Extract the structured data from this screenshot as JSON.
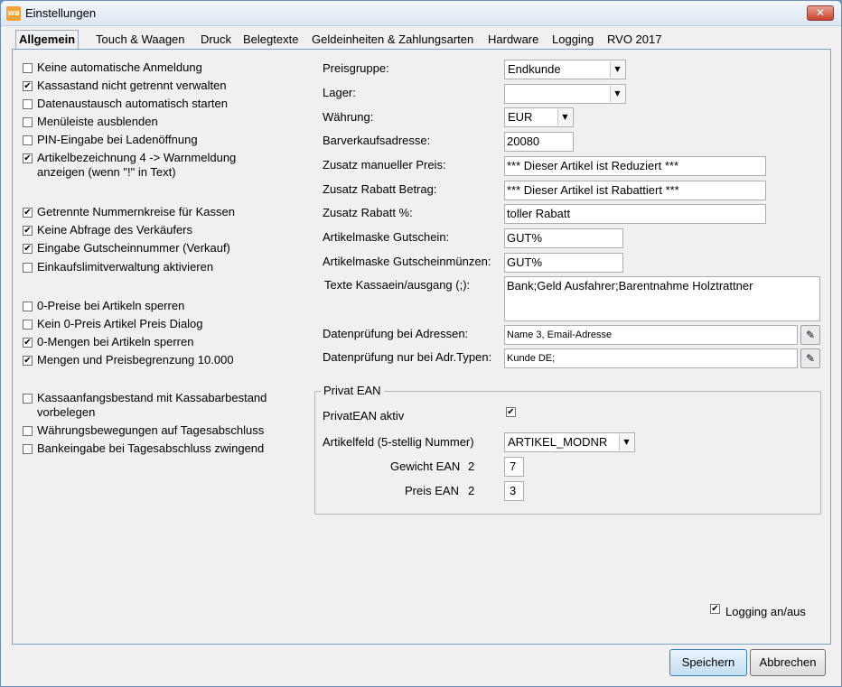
{
  "window": {
    "title": "Einstellungen",
    "icon": "app-icon",
    "close": "✕"
  },
  "tabs": [
    {
      "label": "Allgemein"
    },
    {
      "label": "Touch & Waagen"
    },
    {
      "label": "Druck"
    },
    {
      "label": "Belegtexte"
    },
    {
      "label": "Geldeinheiten & Zahlungsarten"
    },
    {
      "label": "Hardware"
    },
    {
      "label": "Logging"
    },
    {
      "label": "RVO 2017"
    }
  ],
  "checks": [
    {
      "label": "Keine automatische Anmeldung",
      "checked": false
    },
    {
      "label": "Kassastand nicht getrennt verwalten",
      "checked": true
    },
    {
      "label": "Datenaustausch automatisch starten",
      "checked": false
    },
    {
      "label": "Menüleiste ausblenden",
      "checked": false
    },
    {
      "label": "PIN-Eingabe bei Ladenöffnung",
      "checked": false
    },
    {
      "label": "Artikelbezeichnung 4 -> Warnmeldung\nanzeigen (wenn \"!\" in Text)",
      "checked": true
    },
    {
      "label": "Getrennte Nummernkreise für Kassen",
      "checked": true
    },
    {
      "label": "Keine Abfrage des Verkäufers",
      "checked": true
    },
    {
      "label": "Eingabe Gutscheinnummer (Verkauf)",
      "checked": true
    },
    {
      "label": "Einkaufslimitverwaltung aktivieren",
      "checked": false
    },
    {
      "label": "0-Preise bei Artikeln sperren",
      "checked": false
    },
    {
      "label": "Kein 0-Preis Artikel Preis Dialog",
      "checked": false
    },
    {
      "label": "0-Mengen bei Artikeln sperren",
      "checked": true
    },
    {
      "label": "Mengen und Preisbegrenzung 10.000",
      "checked": true
    },
    {
      "label": "Kassaanfangsbestand mit Kassabarbestand\nvorbelegen",
      "checked": false
    },
    {
      "label": "Währungsbewegungen auf Tagesabschluss",
      "checked": false
    },
    {
      "label": "Bankeingabe bei Tagesabschluss zwingend",
      "checked": false
    }
  ],
  "fields": {
    "preisgruppe": {
      "label": "Preisgruppe:",
      "value": "Endkunde"
    },
    "lager": {
      "label": "Lager:",
      "value": ""
    },
    "waehrung": {
      "label": "Währung:",
      "value": "EUR"
    },
    "barverkaufsadresse": {
      "label": "Barverkaufsadresse:",
      "value": "20080"
    },
    "zusatz_manueller_preis": {
      "label": "Zusatz manueller Preis:",
      "value": "*** Dieser Artikel ist Reduziert ***"
    },
    "zusatz_rabatt_betrag": {
      "label": "Zusatz Rabatt Betrag:",
      "value": "*** Dieser Artikel ist Rabattiert ***"
    },
    "zusatz_rabatt_prozent": {
      "label": "Zusatz Rabatt %:",
      "value": "toller Rabatt"
    },
    "artikelmaske_gutschein": {
      "label": "Artikelmaske Gutschein:",
      "value": "GUT%"
    },
    "artikelmaske_gutscheinmuenzen": {
      "label": "Artikelmaske Gutscheinmünzen:",
      "value": "GUT%"
    },
    "texte_kassaein": {
      "label": "Texte Kassaein/ausgang (;):",
      "value": "Bank;Geld Ausfahrer;Barentnahme Holztrattner"
    },
    "datenpruefung_adressen": {
      "label": "Datenprüfung bei Adressen:",
      "value": "Name 3, Email-Adresse"
    },
    "datenpruefung_adr_typen": {
      "label": "Datenprüfung nur bei Adr.Typen:",
      "value": "Kunde DE;"
    }
  },
  "privat_ean": {
    "title": "Privat EAN",
    "aktiv_label": "PrivatEAN aktiv",
    "aktiv_checked": true,
    "artikelfeld_label": "Artikelfeld (5-stellig Nummer)",
    "artikelfeld_value": "ARTIKEL_MODNR",
    "gewicht_label": "Gewicht EAN",
    "gewicht_prefix": "2",
    "gewicht_value": "7",
    "preis_label": "Preis EAN",
    "preis_prefix": "2",
    "preis_value": "3"
  },
  "logging": {
    "label": "Logging an/aus",
    "checked": true
  },
  "buttons": {
    "save": "Speichern",
    "cancel": "Abbrechen"
  },
  "icons": {
    "dropdown": "chevron-down-icon",
    "browse": "folder-edit-icon",
    "check": "✔"
  }
}
